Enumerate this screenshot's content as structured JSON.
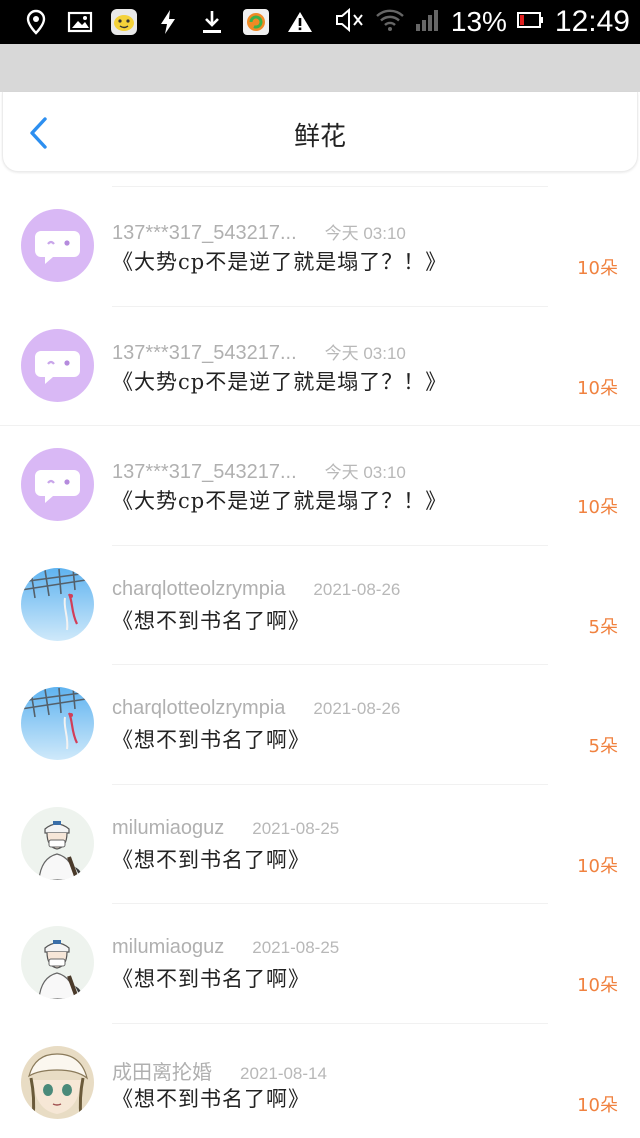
{
  "status_bar": {
    "battery": "13%",
    "time": "12:49",
    "icons": [
      "location-icon",
      "image-icon",
      "app-face-icon",
      "flash-icon",
      "download-icon",
      "app-icon",
      "warning-icon",
      "mute-icon",
      "wifi-icon",
      "signal-icon",
      "battery-icon"
    ]
  },
  "nav": {
    "back_icon": "chevron-left-icon",
    "title": "鲜花"
  },
  "colors": {
    "accent_blue": "#2d8ff0",
    "count_orange": "#f08240",
    "avatar_purple": "#d9b8f5"
  },
  "items": [
    {
      "username": "137***317_543217...",
      "date": "今天 03:10",
      "book": "《大势cp不是逆了就是塌了？！》",
      "count": "10朵",
      "avatar": "chat-bubble-avatar"
    },
    {
      "username": "137***317_543217...",
      "date": "今天 03:10",
      "book": "《大势cp不是逆了就是塌了？！》",
      "count": "10朵",
      "avatar": "chat-bubble-avatar"
    },
    {
      "username": "137***317_543217...",
      "date": "今天 03:10",
      "book": "《大势cp不是逆了就是塌了？！》",
      "count": "10朵",
      "avatar": "chat-bubble-avatar"
    },
    {
      "username": "charqlotteolzrympia",
      "date": "2021-08-26",
      "book": "《想不到书名了啊》",
      "count": "5朵",
      "avatar": "sky-photo-avatar"
    },
    {
      "username": "charqlotteolzrympia",
      "date": "2021-08-26",
      "book": "《想不到书名了啊》",
      "count": "5朵",
      "avatar": "sky-photo-avatar"
    },
    {
      "username": "milumiaoguz",
      "date": "2021-08-25",
      "book": "《想不到书名了啊》",
      "count": "10朵",
      "avatar": "anime-boy-avatar"
    },
    {
      "username": "milumiaoguz",
      "date": "2021-08-25",
      "book": "《想不到书名了啊》",
      "count": "10朵",
      "avatar": "anime-boy-avatar"
    },
    {
      "username": "成田离抡婚",
      "date": "2021-08-14",
      "book": "《想不到书名了啊》",
      "count": "10朵",
      "avatar": "anime-girl-avatar"
    }
  ]
}
